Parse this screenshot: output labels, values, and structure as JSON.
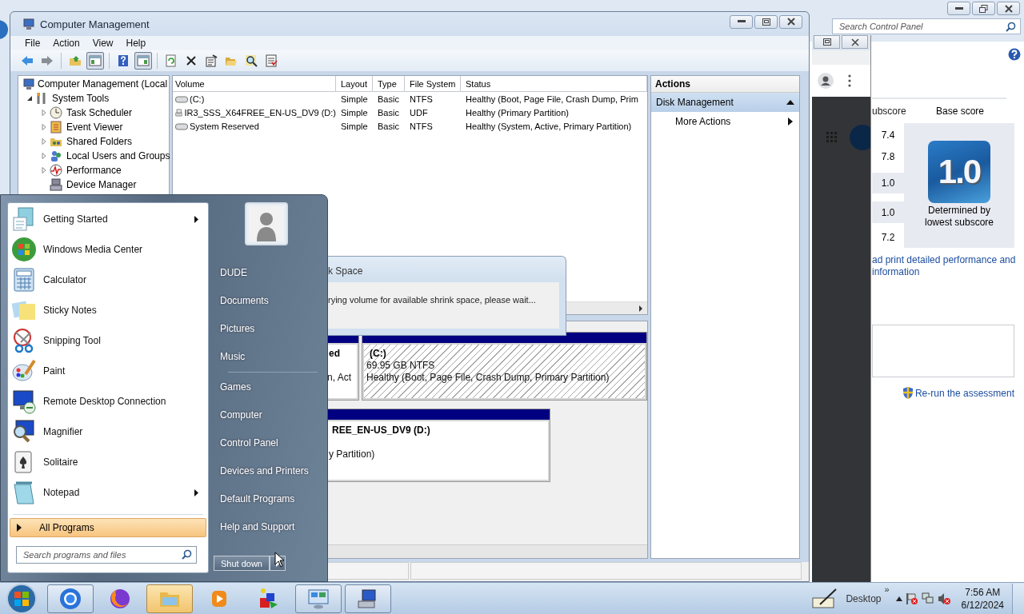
{
  "control_panel": {
    "search": {
      "placeholder": "Search Control Panel"
    },
    "score_header": [
      "ubscore",
      "Base score"
    ],
    "subscores": [
      {
        "value": "7.4",
        "lowest": false
      },
      {
        "value": "7.8",
        "lowest": false
      },
      {
        "value": "1.0",
        "lowest": true
      },
      {
        "value": "1.0",
        "lowest": true
      },
      {
        "value": "7.2",
        "lowest": false
      }
    ],
    "base_score": "1.0",
    "base_note": "Determined by lowest subscore",
    "details_link": [
      "ad print detailed performance and",
      "information"
    ],
    "rerun_link": "Re-run the assessment"
  },
  "computer_management": {
    "title": "Computer Management",
    "menu": [
      "File",
      "Action",
      "View",
      "Help"
    ],
    "toolbar": [
      {
        "kind": "back",
        "pressed": false,
        "separator_before": false
      },
      {
        "kind": "forward",
        "pressed": false,
        "separator_before": false
      },
      {
        "kind": "up",
        "pressed": false,
        "separator_before": true
      },
      {
        "kind": "tree",
        "pressed": true,
        "separator_before": false
      },
      {
        "kind": "help",
        "pressed": false,
        "separator_before": true
      },
      {
        "kind": "pane",
        "pressed": true,
        "separator_before": false
      },
      {
        "kind": "refresh",
        "pressed": false,
        "separator_before": true
      },
      {
        "kind": "delete",
        "pressed": false,
        "separator_before": false
      },
      {
        "kind": "properties",
        "pressed": false,
        "separator_before": false
      },
      {
        "kind": "open",
        "pressed": false,
        "separator_before": false
      },
      {
        "kind": "find",
        "pressed": false,
        "separator_before": false
      },
      {
        "kind": "settings",
        "pressed": false,
        "separator_before": false
      }
    ],
    "tree": {
      "label": "Computer Management (Local",
      "kind": "computer",
      "children": [
        {
          "label": "System Tools",
          "kind": "tools",
          "expanded": true,
          "children": [
            {
              "label": "Task Scheduler",
              "kind": "clock",
              "expanded": false
            },
            {
              "label": "Event Viewer",
              "kind": "event",
              "expanded": false
            },
            {
              "label": "Shared Folders",
              "kind": "shared",
              "expanded": false
            },
            {
              "label": "Local Users and Groups",
              "kind": "users",
              "expanded": false
            },
            {
              "label": "Performance",
              "kind": "performance",
              "expanded": false
            },
            {
              "label": "Device Manager",
              "kind": "device"
            }
          ]
        }
      ]
    },
    "volumes": {
      "columns": [
        "Volume",
        "Layout",
        "Type",
        "File System",
        "Status"
      ],
      "rows": [
        {
          "kind": "disk",
          "cells": [
            "(C:)",
            "Simple",
            "Basic",
            "NTFS",
            "Healthy (Boot, Page File, Crash Dump, Prim"
          ]
        },
        {
          "kind": "cd",
          "cells": [
            "IR3_SSS_X64FREE_EN-US_DV9 (D:)",
            "Simple",
            "Basic",
            "UDF",
            "Healthy (Primary Partition)"
          ]
        },
        {
          "kind": "disk",
          "cells": [
            "System Reserved",
            "Simple",
            "Basic",
            "NTFS",
            "Healthy (System, Active, Primary Partition)"
          ]
        }
      ]
    },
    "disks": [
      {
        "partitions": [
          {
            "name": "ed",
            "status": "n, Act",
            "selected": false
          },
          {
            "name": "(C:)",
            "size": "69.95 GB NTFS",
            "status": "Healthy (Boot, Page File, Crash Dump, Primary Partition)",
            "selected": true
          }
        ]
      },
      {
        "partitions": [
          {
            "name": "REE_EN-US_DV9  (D:)",
            "status": "y Partition)",
            "selected": false
          }
        ]
      }
    ],
    "actions": {
      "title": "Actions",
      "section": "Disk Management",
      "expanded": true,
      "items": [
        {
          "label": "More Actions",
          "submenu": true
        }
      ]
    }
  },
  "dialog": {
    "title": "k Space",
    "message": "rying volume for available shrink space, please wait..."
  },
  "start_menu": {
    "programs": [
      {
        "label": "Getting Started",
        "kind": "getting_started",
        "submenu": true
      },
      {
        "label": "Windows Media Center",
        "kind": "media_center",
        "submenu": false
      },
      {
        "label": "Calculator",
        "kind": "calculator",
        "submenu": false
      },
      {
        "label": "Sticky Notes",
        "kind": "sticky",
        "submenu": false
      },
      {
        "label": "Snipping Tool",
        "kind": "snipping",
        "submenu": false
      },
      {
        "label": "Paint",
        "kind": "paint",
        "submenu": false
      },
      {
        "label": "Remote Desktop Connection",
        "kind": "remote",
        "submenu": false
      },
      {
        "label": "Magnifier",
        "kind": "magnifier",
        "submenu": false
      },
      {
        "label": "Solitaire",
        "kind": "solitaire",
        "submenu": false
      },
      {
        "label": "Notepad",
        "kind": "notepad",
        "submenu": true
      }
    ],
    "all_programs": "All Programs",
    "search": {
      "placeholder": "Search programs and files"
    },
    "places": [
      {
        "label": "DUDE",
        "divider_before": false
      },
      {
        "label": "Documents",
        "divider_before": false
      },
      {
        "label": "Pictures",
        "divider_before": false
      },
      {
        "label": "Music",
        "divider_before": false
      },
      {
        "label": "Games",
        "divider_before": true
      },
      {
        "label": "Computer",
        "divider_before": false
      },
      {
        "label": "Control Panel",
        "divider_before": false
      },
      {
        "label": "Devices and Printers",
        "divider_before": false
      },
      {
        "label": "Default Programs",
        "divider_before": false
      },
      {
        "label": "Help and Support",
        "divider_before": false
      }
    ],
    "shutdown": "Shut down"
  },
  "taskbar": {
    "buttons": [
      {
        "kind": "browser",
        "open": true,
        "flashing": false
      },
      {
        "kind": "firefox",
        "open": false,
        "flashing": false
      },
      {
        "kind": "explorer",
        "open": true,
        "flashing": true
      },
      {
        "kind": "media",
        "open": false,
        "flashing": false
      },
      {
        "kind": "shapes",
        "open": false,
        "flashing": false
      },
      {
        "kind": "control_panel",
        "open": true,
        "flashing": false
      },
      {
        "kind": "management",
        "open": true,
        "flashing": false
      }
    ],
    "toolbar": "Desktop",
    "chevron": "»",
    "time": "7:56 AM",
    "date": "6/12/2024"
  }
}
